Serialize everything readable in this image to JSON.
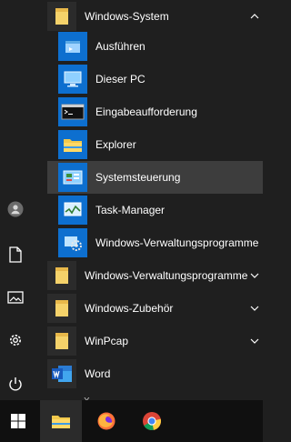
{
  "menu": {
    "items": [
      {
        "label": "Windows-System",
        "icon": "folder-icon",
        "expanded": true
      },
      {
        "label": "Ausführen",
        "icon": "run-icon"
      },
      {
        "label": "Dieser PC",
        "icon": "computer-icon"
      },
      {
        "label": "Eingabeaufforderung",
        "icon": "command-prompt-icon"
      },
      {
        "label": "Explorer",
        "icon": "file-explorer-icon"
      },
      {
        "label": "Systemsteuerung",
        "icon": "control-panel-icon",
        "highlighted": true
      },
      {
        "label": "Task-Manager",
        "icon": "task-manager-icon"
      },
      {
        "label": "Windows-Verwaltungsprogramme",
        "icon": "admin-tools-icon"
      },
      {
        "label": "Windows-Verwaltungsprogramme",
        "icon": "folder-icon"
      },
      {
        "label": "Windows-Zubehör",
        "icon": "folder-icon"
      },
      {
        "label": "WinPcap",
        "icon": "folder-icon"
      },
      {
        "label": "Word",
        "icon": "word-icon"
      }
    ],
    "next_section": "X"
  },
  "colors": {
    "background": "#1f1f1f",
    "tile_blue": "#0d6fcf",
    "highlight": "#3d3d3d",
    "folder": "#f5d26a"
  },
  "rail": [
    "user-icon",
    "documents-icon",
    "pictures-icon",
    "settings-icon",
    "power-icon"
  ],
  "taskbar": [
    "windows-start-icon",
    "file-explorer-icon",
    "firefox-icon",
    "chrome-icon"
  ]
}
